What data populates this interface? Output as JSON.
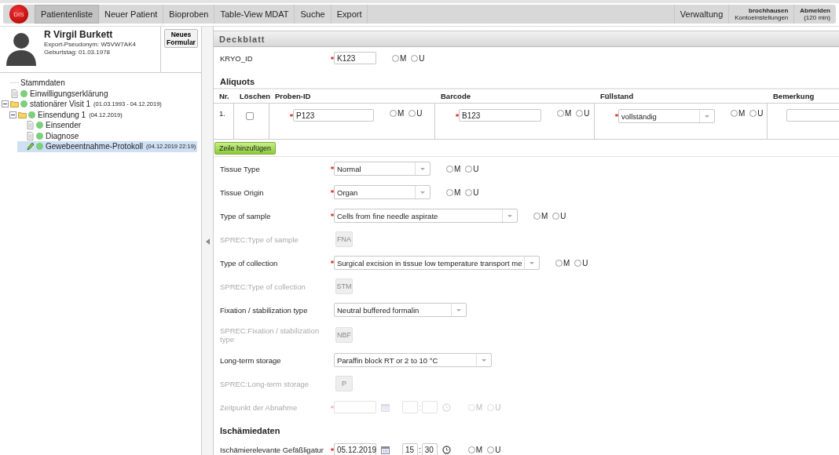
{
  "nav": {
    "logo": "DIS",
    "tabs": [
      {
        "label": "Patientenliste",
        "selected": true
      },
      {
        "label": "Neuer Patient",
        "selected": false
      },
      {
        "label": "Bioproben",
        "selected": false
      },
      {
        "label": "Table-View MDAT",
        "selected": false
      },
      {
        "label": "Suche",
        "selected": false
      },
      {
        "label": "Export",
        "selected": false
      }
    ],
    "admin": "Verwaltung",
    "account": {
      "user": "brochhausen",
      "settings": "Kontoeinstellungen"
    },
    "logout": {
      "label": "Abmelden",
      "timer": "(120 min)"
    }
  },
  "patient": {
    "name": "R Virgil Burkett",
    "pseudonym": "Export-Pseudonym: W5VW7AK4",
    "birthday": "Geburtstag: 01.03.1978",
    "new_form_button": "Neues Formular"
  },
  "tree": [
    {
      "kind": "root",
      "label": "Stammdaten",
      "selected": false
    },
    {
      "kind": "document",
      "label": "Einwilligungserklärung",
      "selected": false
    },
    {
      "kind": "folder",
      "label": "stationärer Visit 1",
      "date": "(01.03.1993 - 04.12.2019)",
      "expanded": true,
      "selected": false,
      "children": [
        {
          "kind": "folder",
          "label": "Einsendung 1",
          "date": "(04.12.2019)",
          "expanded": true,
          "selected": false,
          "children": [
            {
              "kind": "document",
              "label": "Einsender",
              "selected": false
            },
            {
              "kind": "document",
              "label": "Diagnose",
              "selected": false
            },
            {
              "kind": "form",
              "label": "Gewebeentnahme-Protokoll",
              "date": "(04.12.2019 22:19)",
              "selected": true
            }
          ]
        }
      ]
    }
  ],
  "form": {
    "title": "Deckblatt",
    "kryo": {
      "label": "KRYO_ID",
      "value": "K123",
      "required": true,
      "options": [
        {
          "label": "M",
          "selected": false
        },
        {
          "label": "U",
          "selected": false
        }
      ]
    },
    "aliquots": {
      "title": "Aliquots",
      "columns": [
        "Nr.",
        "Löschen",
        "Proben-ID",
        "Barcode",
        "Füllstand",
        "Bemerkung"
      ],
      "rows": [
        {
          "nr": "1.",
          "delete": false,
          "proben_id": {
            "value": "P123",
            "required": true,
            "options": [
              {
                "label": "M",
                "selected": false
              },
              {
                "label": "U",
                "selected": false
              }
            ]
          },
          "barcode": {
            "value": "B123",
            "required": true,
            "options": [
              {
                "label": "M",
                "selected": false
              },
              {
                "label": "U",
                "selected": false
              }
            ]
          },
          "fuellstand": {
            "value": "vollständig",
            "required": true,
            "options": [
              {
                "label": "M",
                "selected": false
              },
              {
                "label": "U",
                "selected": false
              }
            ]
          }
        }
      ],
      "add_button": "Zeile hinzufügen"
    },
    "fields": [
      {
        "kind": "select",
        "label": "Tissue Type",
        "value": "Normal",
        "required": true,
        "options": [
          {
            "label": "M",
            "selected": false
          },
          {
            "label": "U",
            "selected": false
          }
        ]
      },
      {
        "kind": "select",
        "label": "Tissue Origin",
        "value": "Organ",
        "required": true,
        "options": [
          {
            "label": "M",
            "selected": false
          },
          {
            "label": "U",
            "selected": false
          }
        ]
      },
      {
        "kind": "select",
        "label": "Type of sample",
        "value": "Cells from fine needle aspirate",
        "required": true,
        "options": [
          {
            "label": "M",
            "selected": false
          },
          {
            "label": "U",
            "selected": false
          }
        ]
      },
      {
        "kind": "readonly",
        "label": "SPREC:Type of sample",
        "value": "FNA"
      },
      {
        "kind": "select",
        "label": "Type of collection",
        "value": "Surgical excision in tissue low temperature transport me",
        "required": true,
        "options": [
          {
            "label": "M",
            "selected": false
          },
          {
            "label": "U",
            "selected": false
          }
        ]
      },
      {
        "kind": "readonly",
        "label": "SPREC:Type of collection",
        "value": "STM"
      },
      {
        "kind": "select",
        "label": "Fixation / stabilization type",
        "value": "Neutral buffered formalin"
      },
      {
        "kind": "readonly",
        "label": "SPREC:Fixation / stabilization type",
        "value": "NBF"
      },
      {
        "kind": "select",
        "label": "Long-term storage",
        "value": "Paraffin block RT or 2 to 10 °C"
      },
      {
        "kind": "readonly",
        "label": "SPREC:Long-term storage",
        "value": "P"
      },
      {
        "kind": "datetime",
        "label": "Zeitpunkt der Abnahme",
        "required": true,
        "disabled": true,
        "separator": ":",
        "options": [
          {
            "label": "M",
            "selected": false
          },
          {
            "label": "U",
            "selected": false
          }
        ]
      },
      {
        "kind": "heading",
        "label": "Ischämiedaten"
      },
      {
        "kind": "datetime",
        "label": "Ischämierelevante Gefäßligatur",
        "required": true,
        "disabled": false,
        "date": "05.12.2019",
        "hour": "15",
        "separator": ":",
        "minute": "30",
        "options": [
          {
            "label": "M",
            "selected": false
          },
          {
            "label": "U",
            "selected": false
          }
        ]
      }
    ]
  }
}
